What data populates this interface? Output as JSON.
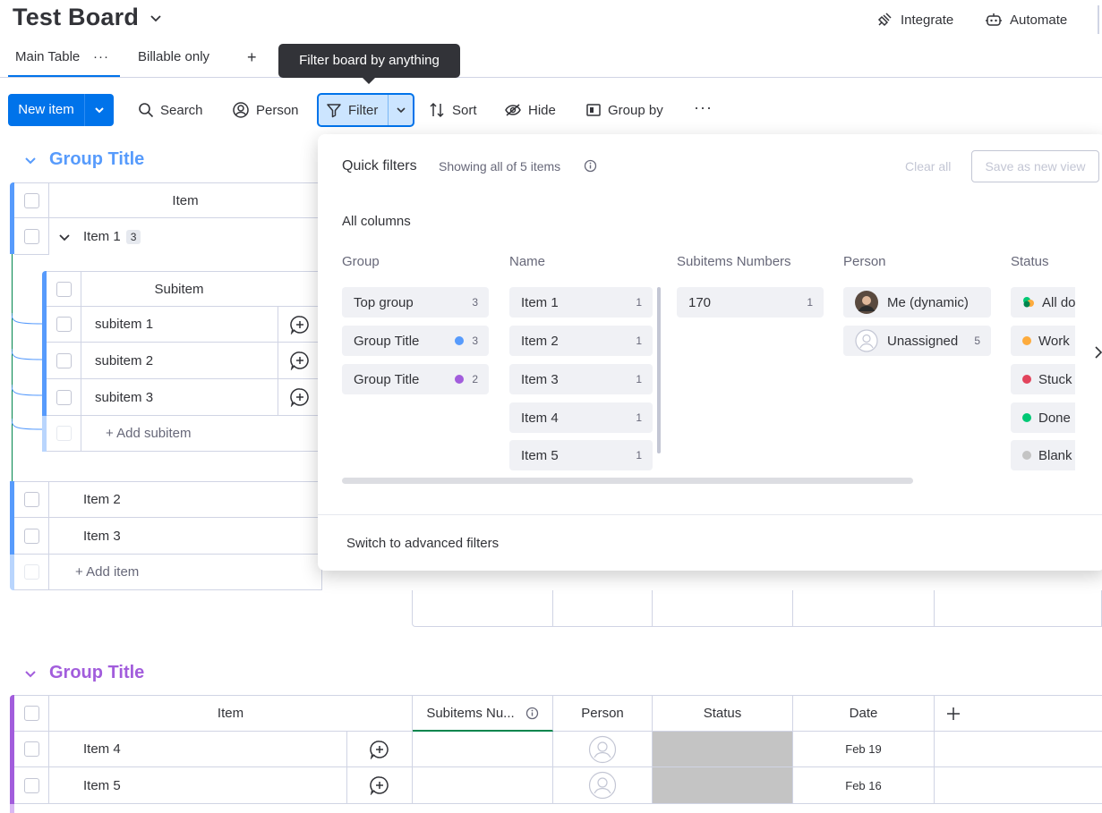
{
  "header": {
    "board_title": "Test Board",
    "integrate": "Integrate",
    "automate": "Automate"
  },
  "tabs": [
    {
      "label": "Main Table"
    },
    {
      "label": "Billable only"
    }
  ],
  "tooltip": "Filter board by anything",
  "toolbar": {
    "new_item": "New item",
    "search": "Search",
    "person": "Person",
    "filter": "Filter",
    "sort": "Sort",
    "hide": "Hide",
    "group_by": "Group by"
  },
  "group1": {
    "title": "Group Title",
    "color": "#579bfc",
    "header_item": "Item",
    "item1": "Item 1",
    "item1_count": "3",
    "subitem_header": "Subitem",
    "subitems": [
      "subitem 1",
      "subitem 2",
      "subitem 3"
    ],
    "add_subitem": "+ Add subitem",
    "items": [
      "Item 2",
      "Item 3"
    ],
    "add_item": "+ Add item"
  },
  "group2": {
    "title": "Group Title",
    "color": "#a25ddc",
    "columns": {
      "item": "Item",
      "subitems": "Subitems Nu...",
      "person": "Person",
      "status": "Status",
      "date": "Date"
    },
    "rows": [
      {
        "name": "Item 4",
        "date": "Feb 19"
      },
      {
        "name": "Item 5",
        "date": "Feb 16"
      }
    ]
  },
  "filter_panel": {
    "title": "Quick filters",
    "showing": "Showing all of 5 items",
    "clear_all": "Clear all",
    "save_view": "Save as new view",
    "all_columns": "All columns",
    "col_group": "Group",
    "col_name": "Name",
    "col_subitems": "Subitems Numbers",
    "col_person": "Person",
    "col_status": "Status",
    "groups": [
      {
        "label": "Top group",
        "count": "3"
      },
      {
        "label": "Group Title",
        "count": "3",
        "color": "#579bfc"
      },
      {
        "label": "Group Title",
        "count": "2",
        "color": "#a25ddc"
      }
    ],
    "names": [
      {
        "label": "Item 1",
        "count": "1"
      },
      {
        "label": "Item 2",
        "count": "1"
      },
      {
        "label": "Item 3",
        "count": "1"
      },
      {
        "label": "Item 4",
        "count": "1"
      },
      {
        "label": "Item 5",
        "count": "1"
      }
    ],
    "subitems": [
      {
        "label": "170",
        "count": "1"
      }
    ],
    "persons": [
      {
        "label": "Me (dynamic)"
      },
      {
        "label": "Unassigned",
        "count": "5"
      }
    ],
    "statuses": [
      {
        "label": "All do",
        "color": "#00c875"
      },
      {
        "label": "Work",
        "color": "#fdab3d"
      },
      {
        "label": "Stuck",
        "color": "#e2445c"
      },
      {
        "label": "Done",
        "color": "#00c875"
      },
      {
        "label": "Blank",
        "color": "#c4c4c4"
      }
    ],
    "switch_advanced": "Switch to advanced filters"
  }
}
